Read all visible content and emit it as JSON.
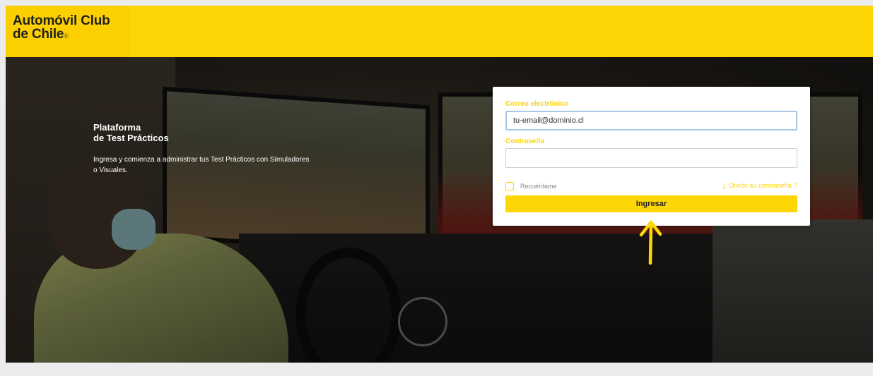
{
  "header": {
    "logo_line1": "Automóvil Club",
    "logo_line2": "de Chile",
    "logo_dot": "®",
    "brand_color": "#FDD605"
  },
  "intro": {
    "title_line1": "Plataforma",
    "title_line2": "de Test Prácticos",
    "description": "Ingresa y comienza a administrar tus Test Prácticos con Simuladores o Visuales."
  },
  "login": {
    "email_label": "Correo electrónico",
    "email_value": "tu-email@dominio.cl",
    "password_label": "Contraseña",
    "password_value": "",
    "remember_label": "Recuérdame",
    "forgot_link": "¿ Olvidó su contraseña ?",
    "submit_label": "Ingresar"
  },
  "annotation": {
    "arrow_color": "#FDD605",
    "arrow_icon": "arrow-up-icon"
  }
}
